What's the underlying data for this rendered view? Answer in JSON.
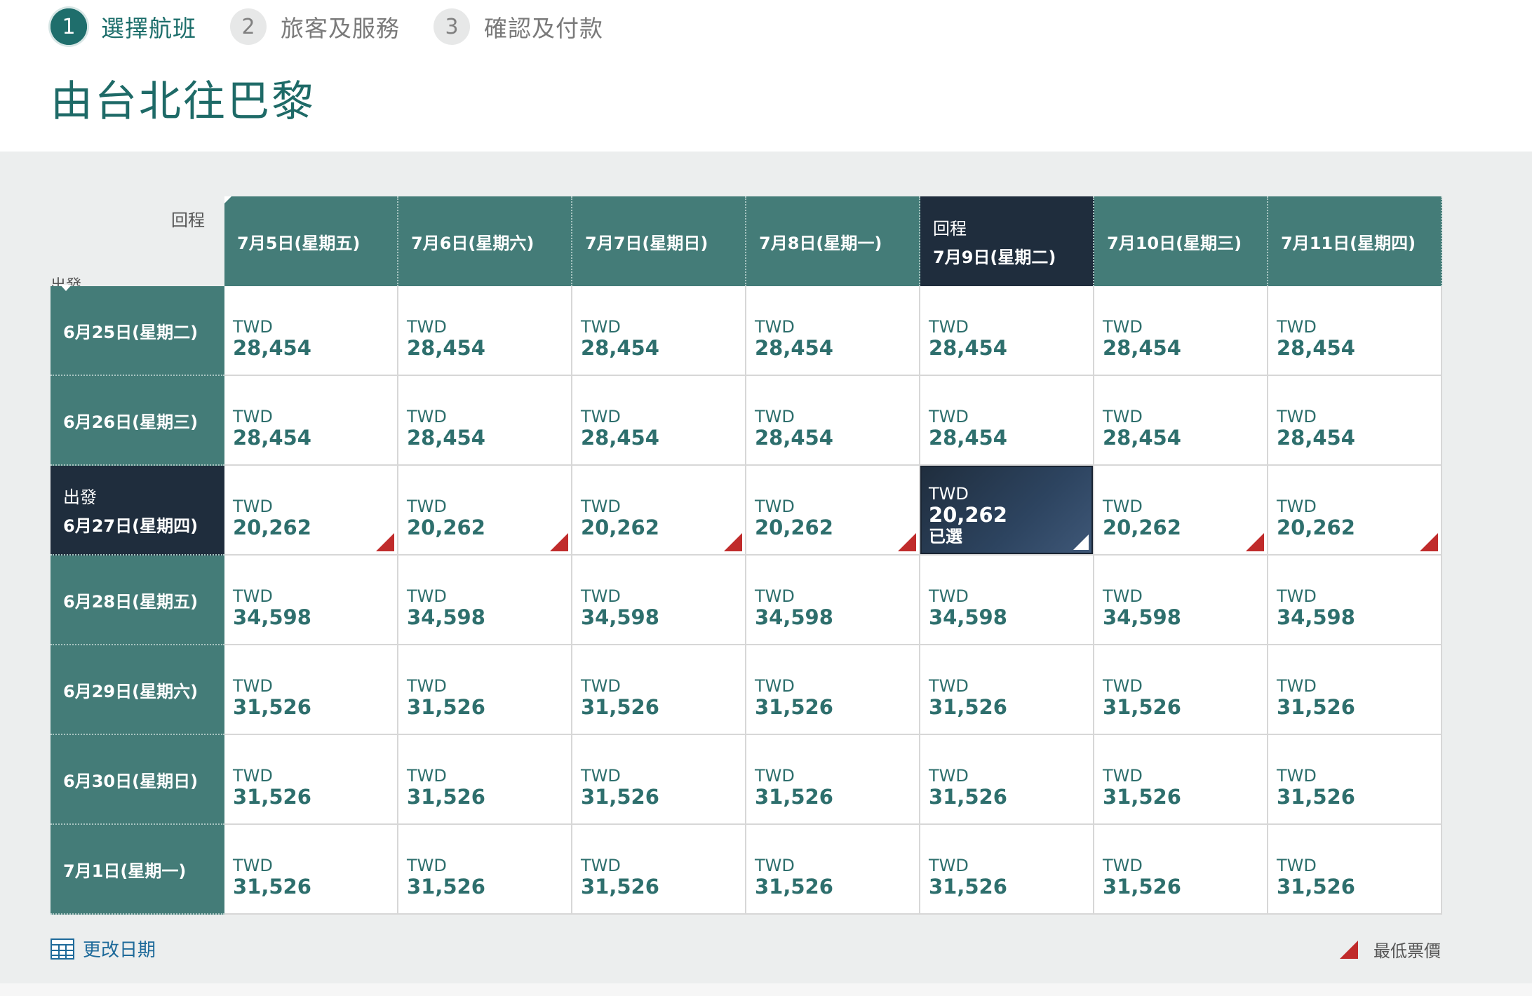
{
  "steps": [
    {
      "num": "1",
      "label": "選擇航班",
      "active": true
    },
    {
      "num": "2",
      "label": "旅客及服務",
      "active": false
    },
    {
      "num": "3",
      "label": "確認及付款",
      "active": false
    }
  ],
  "title": "由台北往巴黎",
  "matrix": {
    "return_axis_label": "回程",
    "depart_axis_label": "出發",
    "currency": "TWD",
    "selected_label": "已選",
    "selected_return_prefix": "回程",
    "selected_depart_prefix": "出發",
    "return_dates": [
      "7月5日(星期五)",
      "7月6日(星期六)",
      "7月7日(星期日)",
      "7月8日(星期一)",
      "7月9日(星期二)",
      "7月10日(星期三)",
      "7月11日(星期四)"
    ],
    "depart_dates": [
      "6月25日(星期二)",
      "6月26日(星期三)",
      "6月27日(星期四)",
      "6月28日(星期五)",
      "6月29日(星期六)",
      "6月30日(星期日)",
      "7月1日(星期一)"
    ],
    "selected_return_index": 4,
    "selected_depart_index": 2,
    "prices": [
      [
        "28,454",
        "28,454",
        "28,454",
        "28,454",
        "28,454",
        "28,454",
        "28,454"
      ],
      [
        "28,454",
        "28,454",
        "28,454",
        "28,454",
        "28,454",
        "28,454",
        "28,454"
      ],
      [
        "20,262",
        "20,262",
        "20,262",
        "20,262",
        "20,262",
        "20,262",
        "20,262"
      ],
      [
        "34,598",
        "34,598",
        "34,598",
        "34,598",
        "34,598",
        "34,598",
        "34,598"
      ],
      [
        "31,526",
        "31,526",
        "31,526",
        "31,526",
        "31,526",
        "31,526",
        "31,526"
      ],
      [
        "31,526",
        "31,526",
        "31,526",
        "31,526",
        "31,526",
        "31,526",
        "31,526"
      ],
      [
        "31,526",
        "31,526",
        "31,526",
        "31,526",
        "31,526",
        "31,526",
        "31,526"
      ]
    ],
    "lowest_row_index": 2
  },
  "footer": {
    "change_date_label": "更改日期",
    "change_date_icon": "calendar-icon",
    "legend_label": "最低票價",
    "legend_icon": "lowest-fare-marker-icon"
  },
  "colors": {
    "header_teal": "#447c78",
    "selected_navy": "#1f2d3d",
    "price_teal": "#2e6f6d",
    "lowest_marker_red": "#c02b2b",
    "link_blue": "#1e6a9a"
  }
}
